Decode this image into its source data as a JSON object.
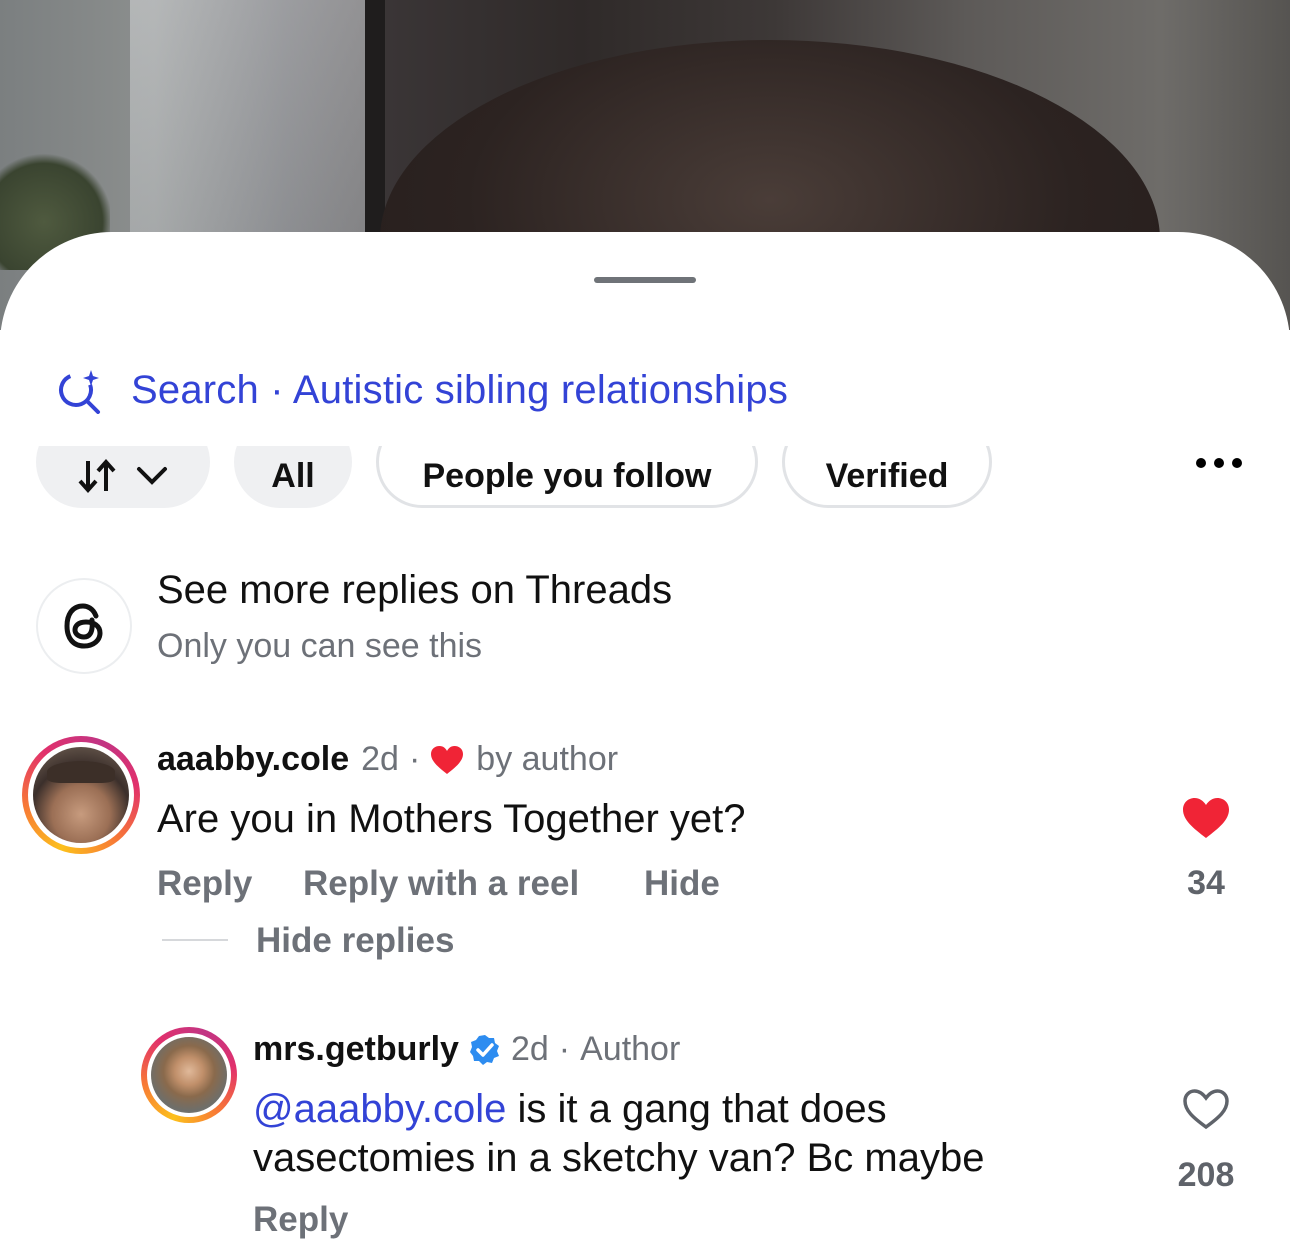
{
  "search": {
    "label": "Search",
    "separator": "·",
    "query": "Autistic sibling relationships"
  },
  "filters": {
    "sort_icon": "sort-arrows-icon",
    "chips": [
      "All",
      "People you follow",
      "Verified"
    ]
  },
  "threads_prompt": {
    "title": "See more replies on Threads",
    "subtitle": "Only you can see this"
  },
  "comments": [
    {
      "username": "aaabby.cole",
      "time": "2d",
      "separator": "·",
      "liked_by_author": "by author",
      "text": "Are you in Mothers Together yet?",
      "actions": [
        "Reply",
        "Reply with a reel",
        "Hide"
      ],
      "likes": "34",
      "liked": true,
      "toggle_replies": "Hide replies"
    },
    {
      "username": "mrs.getburly",
      "verified": true,
      "time": "2d",
      "separator": "·",
      "role": "Author",
      "mention": "@aaabby.cole",
      "text": " is it a gang that does vasectomies in a sketchy van? Bc maybe",
      "actions": [
        "Reply"
      ],
      "likes": "208",
      "liked": false
    }
  ],
  "colors": {
    "link_blue": "#3343d6",
    "heart_red": "#f02436",
    "secondary_text": "#6d7178",
    "verified_blue": "#2d8cf0"
  }
}
